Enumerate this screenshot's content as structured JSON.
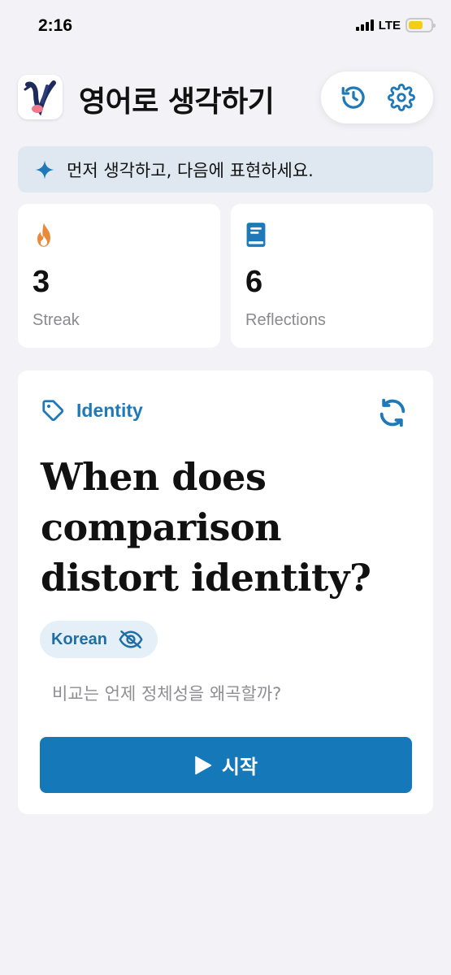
{
  "status_bar": {
    "time": "2:16",
    "network": "LTE",
    "battery_level": 0.65
  },
  "header": {
    "app_title": "영어로 생각하기",
    "icons": {
      "history": "history-icon",
      "settings": "gear-icon"
    }
  },
  "banner": {
    "icon": "sparkle-icon",
    "text": "먼저 생각하고, 다음에 표현하세요."
  },
  "stats": [
    {
      "icon": "flame-icon",
      "value": "3",
      "label": "Streak"
    },
    {
      "icon": "book-icon",
      "value": "6",
      "label": "Reflections"
    }
  ],
  "prompt": {
    "topic_icon": "tag-icon",
    "topic": "Identity",
    "refresh_icon": "refresh-icon",
    "question": "When does comparison distort identity?",
    "language_chip": {
      "label": "Korean",
      "icon": "eye-off-icon"
    },
    "translation": "비교는 언제 정체성을 왜곡할까?",
    "start_button": {
      "icon": "play-icon",
      "label": "시작"
    }
  },
  "colors": {
    "accent": "#1578b9",
    "background": "#f2f2f7",
    "card": "#ffffff",
    "banner": "#dfe8f1",
    "streak_flame": "#e98a3b"
  }
}
